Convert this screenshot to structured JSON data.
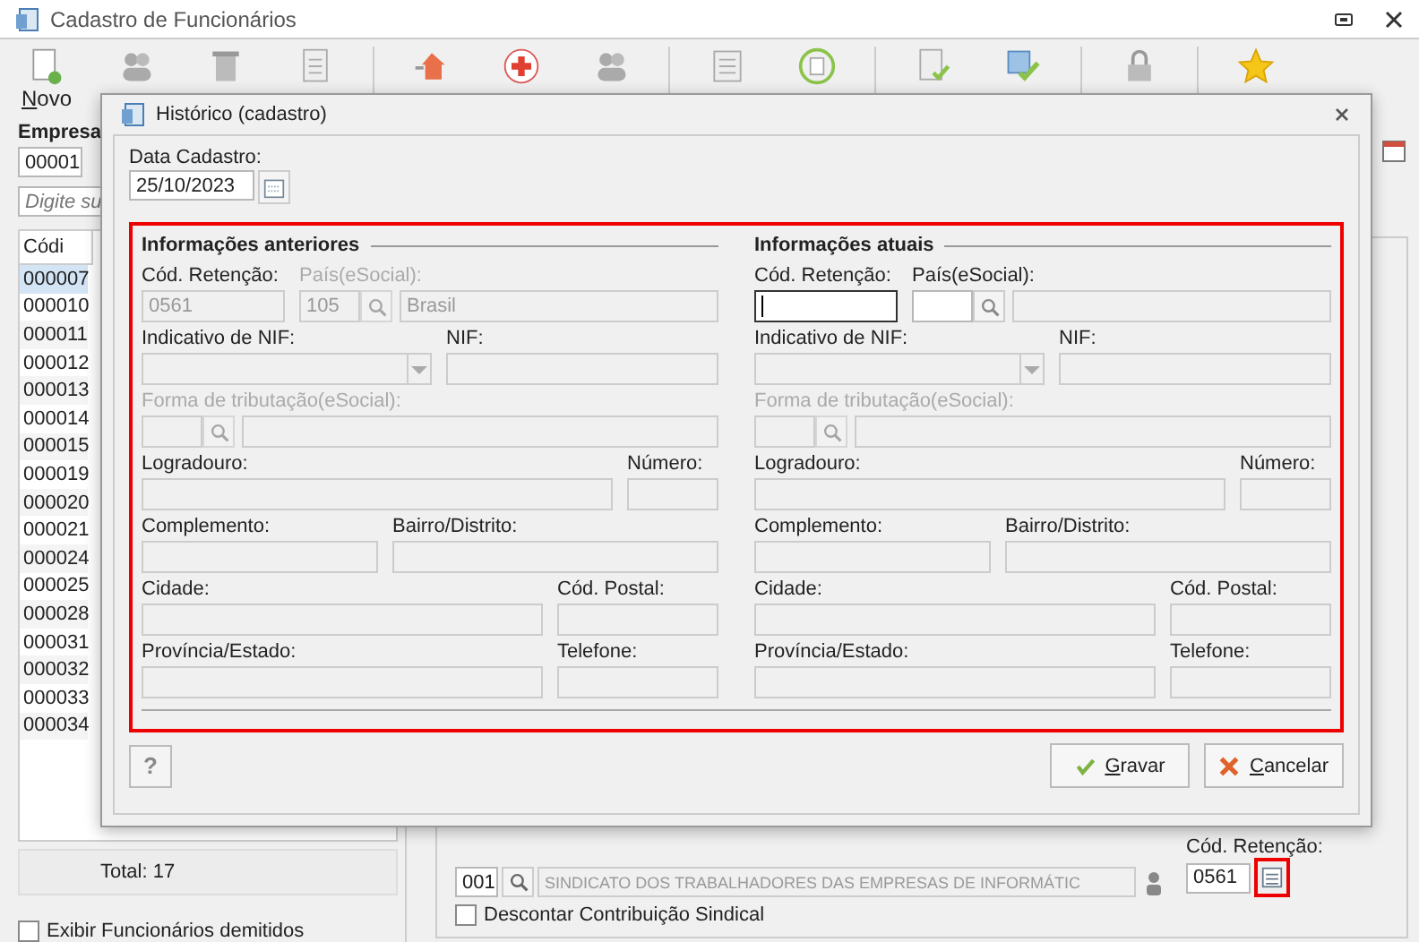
{
  "window": {
    "title": "Cadastro de Funcionários"
  },
  "toolbar": [
    {
      "kind": "new",
      "label": "Novo"
    },
    {
      "kind": "people"
    },
    {
      "kind": "trash"
    },
    {
      "kind": "doc"
    },
    {
      "kind": "sep"
    },
    {
      "kind": "home"
    },
    {
      "kind": "cross"
    },
    {
      "kind": "people"
    },
    {
      "kind": "sep"
    },
    {
      "kind": "list"
    },
    {
      "kind": "cycle"
    },
    {
      "kind": "sep"
    },
    {
      "kind": "doccheck"
    },
    {
      "kind": "check"
    },
    {
      "kind": "sep"
    },
    {
      "kind": "lock"
    },
    {
      "kind": "sep"
    },
    {
      "kind": "star"
    }
  ],
  "sidebar": {
    "empresa_label": "Empresa",
    "empresa_code": "00001",
    "search_placeholder": "Digite su",
    "column": "Códi",
    "rows": [
      {
        "code": "000007",
        "selected": true
      },
      {
        "code": "000010",
        "selected": false
      },
      {
        "code": "000011",
        "selected": false
      },
      {
        "code": "000012",
        "selected": false
      },
      {
        "code": "000013",
        "selected": false
      },
      {
        "code": "000014",
        "selected": false
      },
      {
        "code": "000015",
        "selected": false
      },
      {
        "code": "000019",
        "selected": false
      },
      {
        "code": "000020",
        "selected": false
      },
      {
        "code": "000021",
        "selected": false
      },
      {
        "code": "000024",
        "selected": false
      },
      {
        "code": "000025",
        "selected": false
      },
      {
        "code": "000028",
        "selected": false
      },
      {
        "code": "000031",
        "selected": false
      },
      {
        "code": "000032",
        "selected": false
      },
      {
        "code": "000033",
        "selected": false
      },
      {
        "code": "000034",
        "selected": false
      }
    ],
    "total": "Total: 17",
    "show_dismissed": {
      "label": "Exibir Funcionários demitidos",
      "checked": false
    }
  },
  "background_form": {
    "sindicato_code": "001",
    "sindicato_name": "SINDICATO DOS TRABALHADORES DAS EMPRESAS DE INFORMÁTIC",
    "retention_label": "Cód. Retenção:",
    "retention_value": "0561",
    "discount": {
      "label": "Descontar Contribuição Sindical",
      "checked": false
    }
  },
  "dialog": {
    "title": "Histórico (cadastro)",
    "date_label": "Data Cadastro:",
    "date_value": "25/10/2023",
    "panels": [
      {
        "title": "Informações anteriores",
        "rows": [
          [
            {
              "kind": "text",
              "label": "Cód. Retenção:",
              "value": "0561",
              "editable": false,
              "label_disabled": false
            },
            {
              "kind": "lookup",
              "label": "País(eSocial):",
              "value": "105",
              "name": "Brasil",
              "editable": false,
              "label_disabled": true
            }
          ],
          [
            {
              "kind": "select",
              "label": "Indicativo de NIF:",
              "editable": false,
              "label_disabled": false
            },
            {
              "kind": "text",
              "label": "NIF:",
              "editable": false,
              "label_disabled": false
            }
          ],
          [
            {
              "kind": "lookup",
              "label": "Forma de tributação(eSocial):",
              "editable": false,
              "label_disabled": true
            }
          ],
          [
            {
              "kind": "text",
              "label": "Logradouro:",
              "editable": false,
              "label_disabled": false
            },
            {
              "kind": "text",
              "label": "Número:",
              "editable": false,
              "label_disabled": false
            }
          ],
          [
            {
              "kind": "text",
              "label": "Complemento:",
              "editable": false,
              "label_disabled": false
            },
            {
              "kind": "text",
              "label": "Bairro/Distrito:",
              "editable": false,
              "label_disabled": false
            }
          ],
          [
            {
              "kind": "text",
              "label": "Cidade:",
              "editable": false,
              "label_disabled": false
            },
            {
              "kind": "text",
              "label": "Cód. Postal:",
              "editable": false,
              "label_disabled": false
            }
          ],
          [
            {
              "kind": "text",
              "label": "Província/Estado:",
              "editable": false,
              "label_disabled": false
            },
            {
              "kind": "text",
              "label": "Telefone:",
              "editable": false,
              "label_disabled": false
            }
          ]
        ]
      },
      {
        "title": "Informações atuais",
        "rows": [
          [
            {
              "kind": "text",
              "label": "Cód. Retenção:",
              "editable": true,
              "label_disabled": false,
              "focused": true
            },
            {
              "kind": "lookup",
              "label": "País(eSocial):",
              "editable": true,
              "label_disabled": false
            }
          ],
          [
            {
              "kind": "select",
              "label": "Indicativo de NIF:",
              "editable": false,
              "label_disabled": false
            },
            {
              "kind": "text",
              "label": "NIF:",
              "editable": false,
              "label_disabled": false
            }
          ],
          [
            {
              "kind": "lookup",
              "label": "Forma de tributação(eSocial):",
              "editable": false,
              "label_disabled": true
            }
          ],
          [
            {
              "kind": "text",
              "label": "Logradouro:",
              "editable": false,
              "label_disabled": false
            },
            {
              "kind": "text",
              "label": "Número:",
              "editable": false,
              "label_disabled": false
            }
          ],
          [
            {
              "kind": "text",
              "label": "Complemento:",
              "editable": false,
              "label_disabled": false
            },
            {
              "kind": "text",
              "label": "Bairro/Distrito:",
              "editable": false,
              "label_disabled": false
            }
          ],
          [
            {
              "kind": "text",
              "label": "Cidade:",
              "editable": false,
              "label_disabled": false
            },
            {
              "kind": "text",
              "label": "Cód. Postal:",
              "editable": false,
              "label_disabled": false
            }
          ],
          [
            {
              "kind": "text",
              "label": "Província/Estado:",
              "editable": false,
              "label_disabled": false
            },
            {
              "kind": "text",
              "label": "Telefone:",
              "editable": false,
              "label_disabled": false
            }
          ]
        ]
      }
    ],
    "help": "?",
    "buttons": [
      {
        "kind": "save",
        "label": "Gravar"
      },
      {
        "kind": "cancel",
        "label": "Cancelar"
      }
    ]
  }
}
